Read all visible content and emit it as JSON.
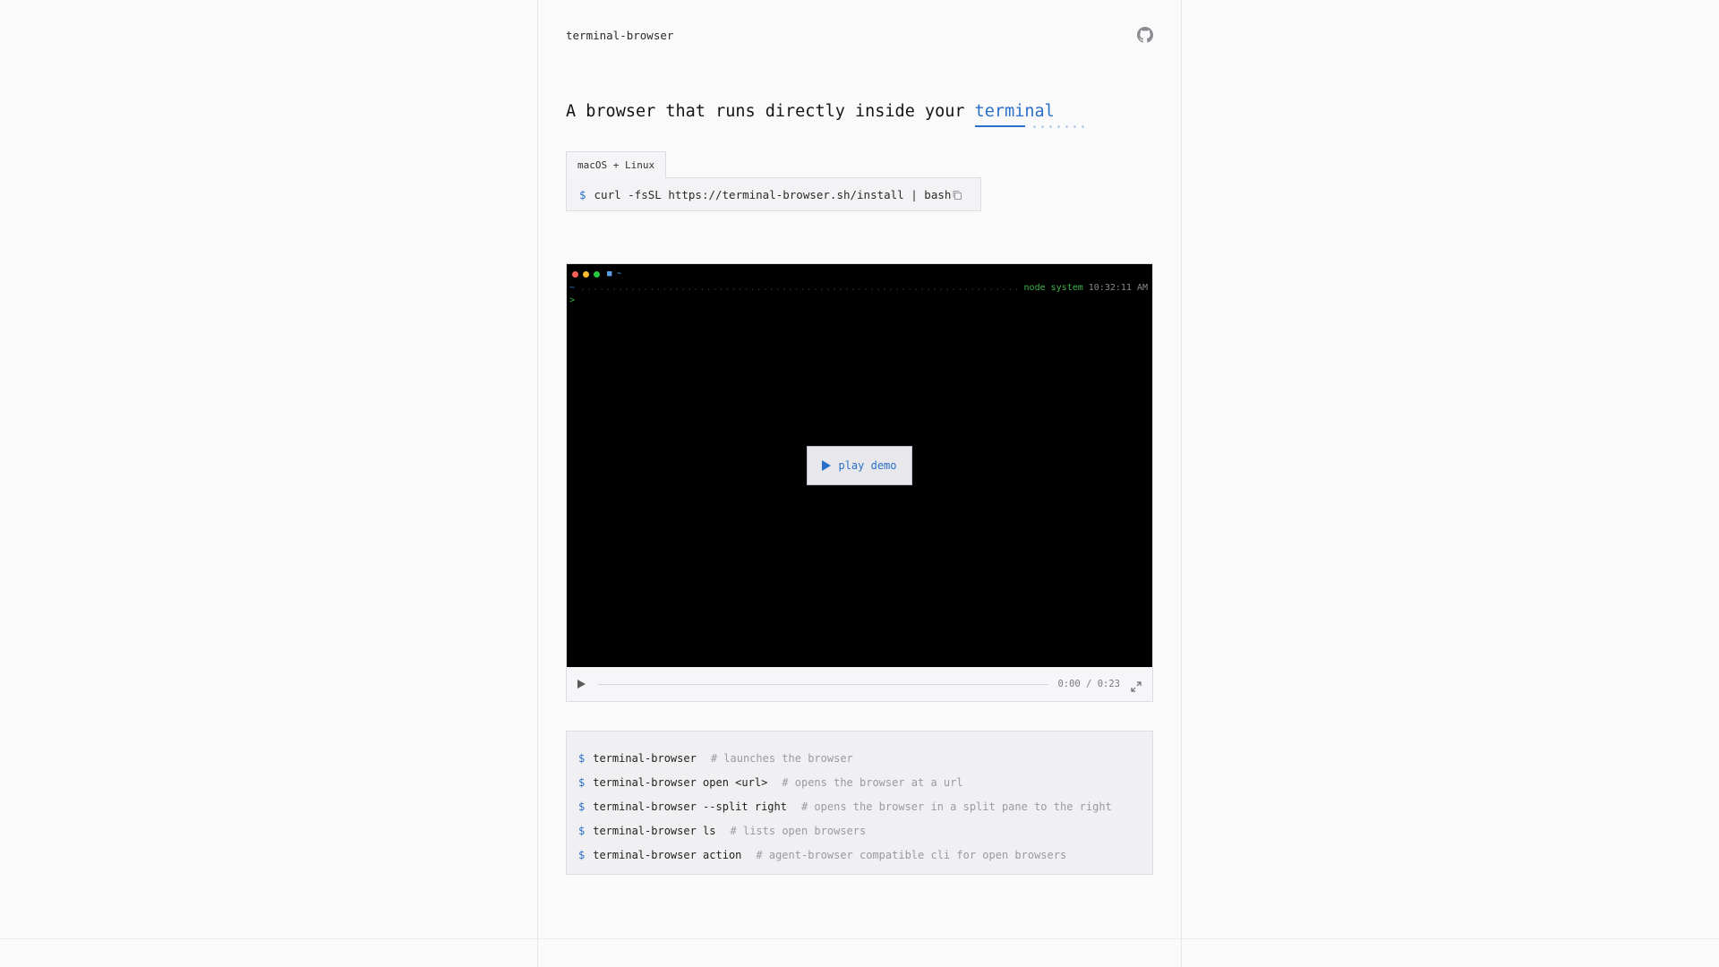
{
  "header": {
    "brand": "terminal-browser",
    "github_icon": "github-icon"
  },
  "headline": {
    "prefix": "A browser that runs directly inside your ",
    "accent": "terminal"
  },
  "install": {
    "tab_label": "macOS + Linux",
    "prompt": "$",
    "command": "curl -fsSL https://terminal-browser.sh/install | bash",
    "copy_icon": "copy-icon"
  },
  "demo": {
    "terminal": {
      "folder": "■ ~",
      "path": "~",
      "status_node": "node system",
      "time": "10:32:11 AM",
      "prompt": ">"
    },
    "play_label": "play demo",
    "time_display": "0:00 / 0:23",
    "progress": 0
  },
  "commands": [
    {
      "prompt": "$",
      "cmd": "terminal-browser",
      "comment": "# launches the browser"
    },
    {
      "prompt": "$",
      "cmd": "terminal-browser open <url>",
      "comment": "# opens the browser at a url"
    },
    {
      "prompt": "$",
      "cmd": "terminal-browser --split right",
      "comment": "# opens the browser in a split pane to the right"
    },
    {
      "prompt": "$",
      "cmd": "terminal-browser ls",
      "comment": "# lists open browsers"
    },
    {
      "prompt": "$",
      "cmd": "terminal-browser action",
      "comment": "# agent-browser compatible cli for open browsers"
    }
  ],
  "colors": {
    "accent": "#2a6fc9",
    "prompt_green": "#3fb44a"
  }
}
